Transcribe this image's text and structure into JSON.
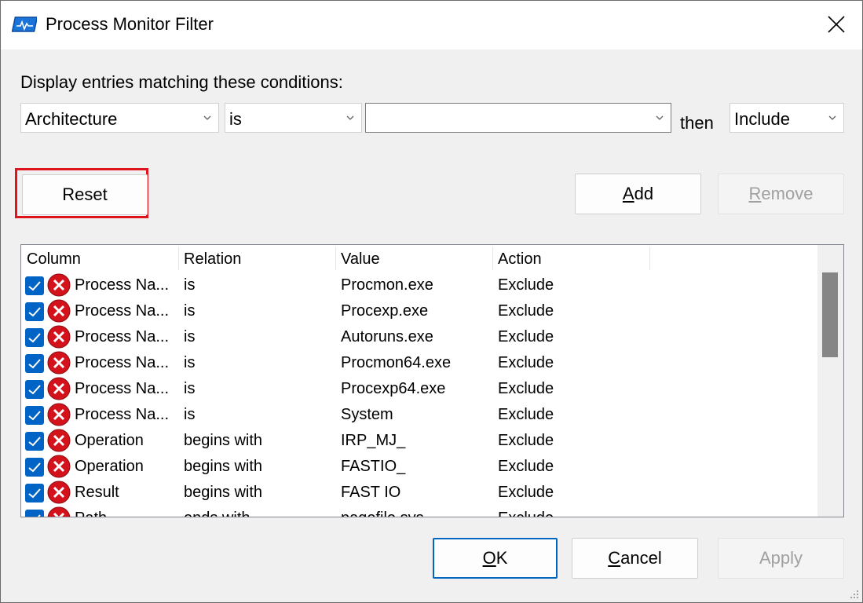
{
  "window": {
    "title": "Process Monitor Filter"
  },
  "conditions_label": "Display entries matching these conditions:",
  "filter": {
    "column": "Architecture",
    "relation": "is",
    "value": "",
    "then_label": "then",
    "action": "Include"
  },
  "buttons": {
    "reset": "Reset",
    "add_prefix": "",
    "add_key": "A",
    "add_rest": "dd",
    "remove_key": "R",
    "remove_rest": "emove",
    "ok_key": "O",
    "ok_rest": "K",
    "cancel_key": "C",
    "cancel_rest": "ancel",
    "apply": "Apply"
  },
  "list": {
    "headers": [
      "Column",
      "Relation",
      "Value",
      "Action"
    ],
    "rows": [
      {
        "column": "Process Na...",
        "relation": "is",
        "value": "Procmon.exe",
        "action": "Exclude"
      },
      {
        "column": "Process Na...",
        "relation": "is",
        "value": "Procexp.exe",
        "action": "Exclude"
      },
      {
        "column": "Process Na...",
        "relation": "is",
        "value": "Autoruns.exe",
        "action": "Exclude"
      },
      {
        "column": "Process Na...",
        "relation": "is",
        "value": "Procmon64.exe",
        "action": "Exclude"
      },
      {
        "column": "Process Na...",
        "relation": "is",
        "value": "Procexp64.exe",
        "action": "Exclude"
      },
      {
        "column": "Process Na...",
        "relation": "is",
        "value": "System",
        "action": "Exclude"
      },
      {
        "column": "Operation",
        "relation": "begins with",
        "value": "IRP_MJ_",
        "action": "Exclude"
      },
      {
        "column": "Operation",
        "relation": "begins with",
        "value": "FASTIO_",
        "action": "Exclude"
      },
      {
        "column": "Result",
        "relation": "begins with",
        "value": "FAST IO",
        "action": "Exclude"
      },
      {
        "column": "Path",
        "relation": "ends with",
        "value": "pagefile.sys",
        "action": "Exclude"
      }
    ]
  },
  "colors": {
    "accent": "#0067c0",
    "checkbox": "#0063c6",
    "exclude_icon": "#d4121b",
    "highlight": "#e0141c"
  },
  "icons": {
    "app": "process-monitor-icon",
    "close": "close-icon",
    "chevron": "chevron-down-icon",
    "exclude": "exclude-x-icon",
    "checkbox": "checkmark-icon"
  }
}
